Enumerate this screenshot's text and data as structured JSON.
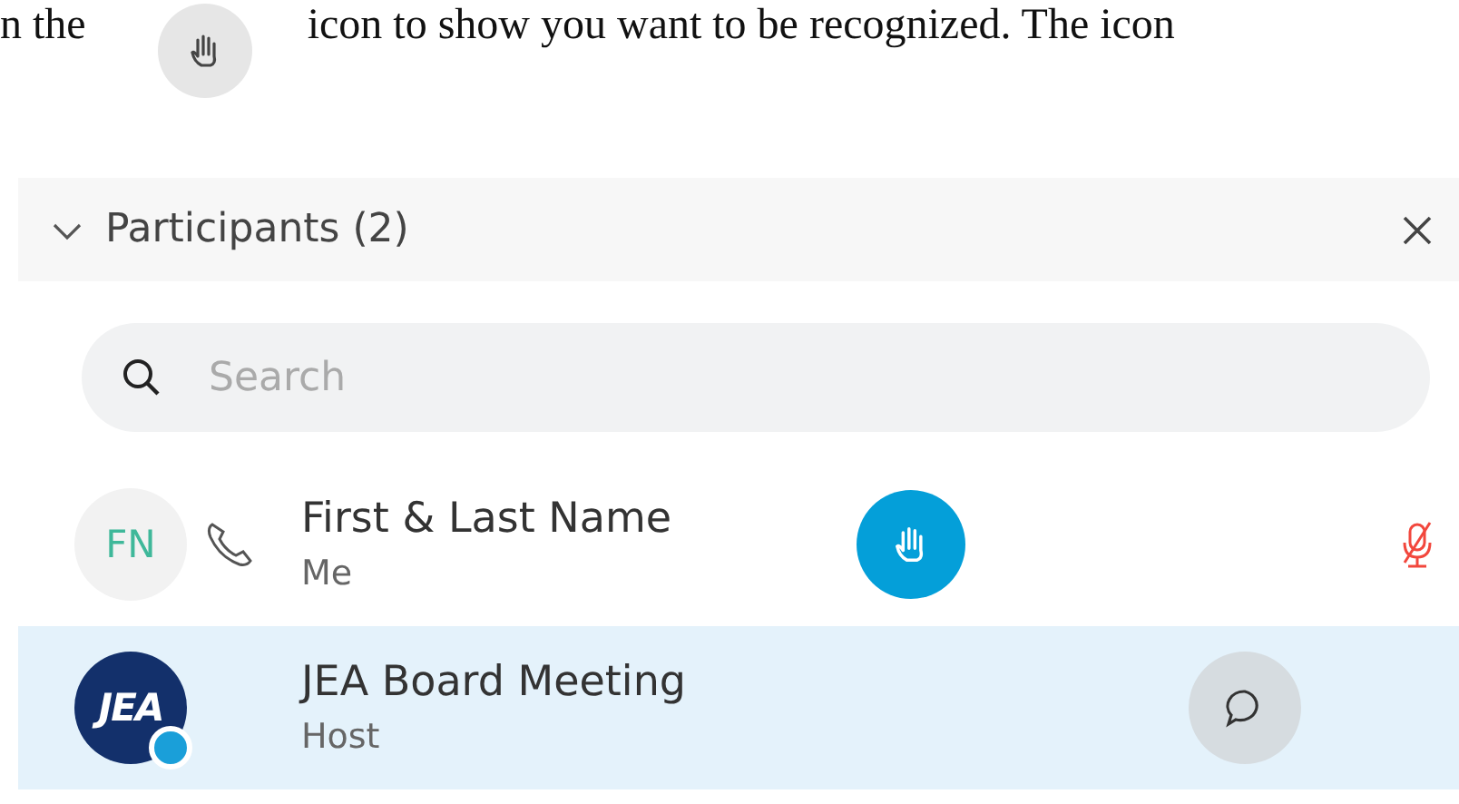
{
  "document_text": {
    "before": "n the",
    "after": "icon to show you want to be recognized.  The icon"
  },
  "panel": {
    "title": "Participants (2)",
    "expanded": true
  },
  "search": {
    "placeholder": "Search"
  },
  "participants": [
    {
      "name": "First & Last Name",
      "role": "Me",
      "initials": "FN",
      "on_phone": true,
      "hand_raised": true,
      "muted": true,
      "chat_button": false,
      "selected": false
    },
    {
      "name": "JEA Board Meeting",
      "role": "Host",
      "logo_text": "JEA",
      "on_phone": false,
      "hand_raised": false,
      "muted": false,
      "chat_button": true,
      "selected": true
    }
  ]
}
